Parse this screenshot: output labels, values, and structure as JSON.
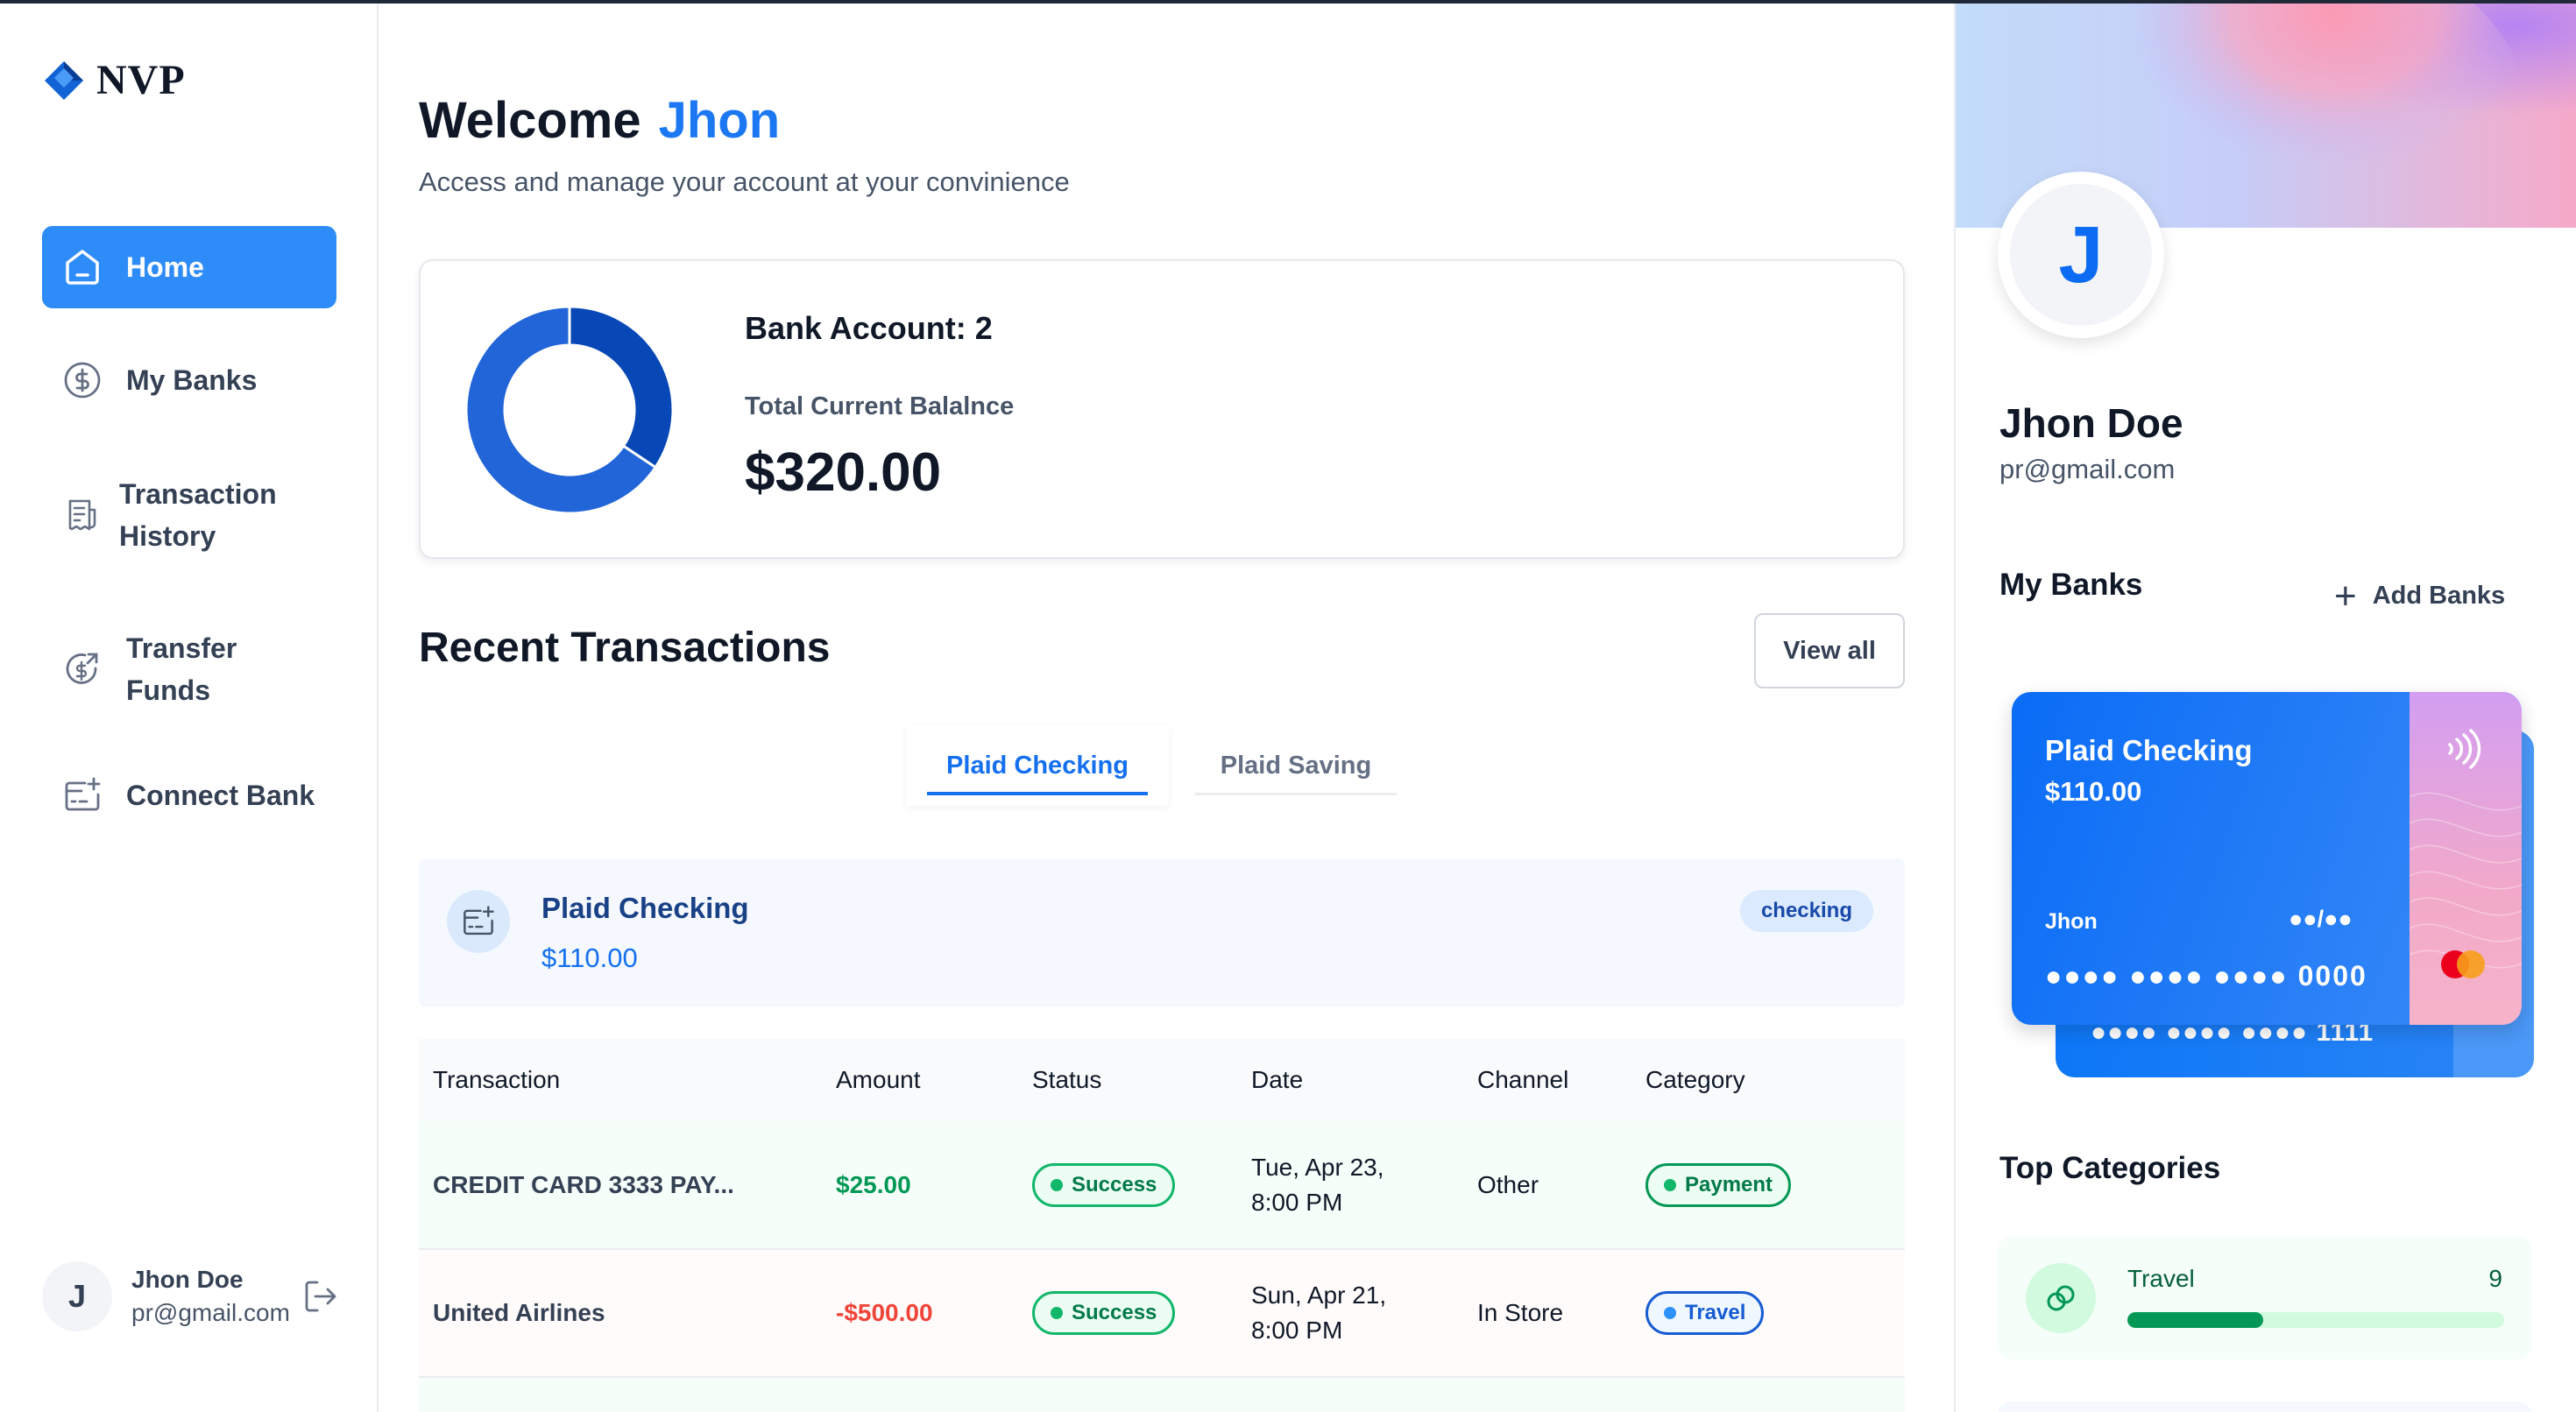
{
  "app": {
    "logo_text": "NVP"
  },
  "sidebar": {
    "items": [
      {
        "label": "Home",
        "icon": "home-icon",
        "active": true
      },
      {
        "label": "My Banks",
        "icon": "dollar-circle-icon"
      },
      {
        "label": "Transaction History",
        "line1": "Transaction",
        "line2": "History",
        "icon": "receipt-icon"
      },
      {
        "label": "Transfer Funds",
        "line1": "Transfer",
        "line2": "Funds",
        "icon": "transfer-icon"
      },
      {
        "label": "Connect Bank",
        "icon": "bank-card-icon"
      }
    ],
    "footer": {
      "avatar_letter": "J",
      "name": "Jhon Doe",
      "email": "pr@gmail.com"
    }
  },
  "header": {
    "welcome": "Welcome",
    "user_first_name": "Jhon",
    "subtitle": "Access and manage your account at your convinience"
  },
  "balance": {
    "bank_count_label": "Bank Account: 2",
    "total_label": "Total Current Balalnce",
    "total_value": "$320.00",
    "donut_segments": [
      {
        "label": "Plaid Checking",
        "value": 110,
        "color": "#0747b6"
      },
      {
        "label": "Plaid Saving",
        "value": 210,
        "color": "#2265d8"
      }
    ]
  },
  "recent": {
    "title": "Recent Transactions",
    "view_all_label": "View all",
    "tabs": [
      {
        "label": "Plaid Checking",
        "active": true
      },
      {
        "label": "Plaid Saving",
        "active": false
      }
    ],
    "account": {
      "name": "Plaid Checking",
      "balance": "$110.00",
      "type_badge": "checking"
    },
    "columns": [
      "Transaction",
      "Amount",
      "Status",
      "Date",
      "Channel",
      "Category"
    ],
    "rows": [
      {
        "name": "CREDIT CARD 3333 PAY...",
        "amount": "$25.00",
        "status": "Success",
        "date_line1": "Tue, Apr 23,",
        "date_line2": "8:00 PM",
        "channel": "Other",
        "category": "Payment"
      },
      {
        "name": "United Airlines",
        "amount": "-$500.00",
        "status": "Success",
        "date_line1": "Sun, Apr 21,",
        "date_line2": "8:00 PM",
        "channel": "In Store",
        "category": "Travel"
      }
    ]
  },
  "profile": {
    "avatar_letter": "J",
    "name": "Jhon Doe",
    "email": "pr@gmail.com"
  },
  "my_banks": {
    "title": "My Banks",
    "add_label": "Add Banks",
    "front_card": {
      "bank": "Plaid Checking",
      "amount": "$110.00",
      "holder": "Jhon",
      "expiry": "●●/●●",
      "number": "●●●● ●●●● ●●●● 0000"
    },
    "back_card": {
      "number": "●●●● ●●●● ●●●● 1111"
    }
  },
  "top_categories": {
    "title": "Top Categories",
    "items": [
      {
        "name": "Travel",
        "count": "9",
        "progress": 0.36
      }
    ]
  },
  "colors": {
    "accent": "#2e8cf8",
    "brand_blue": "#1b78f2",
    "success": "#12b76a",
    "danger": "#f04438"
  }
}
